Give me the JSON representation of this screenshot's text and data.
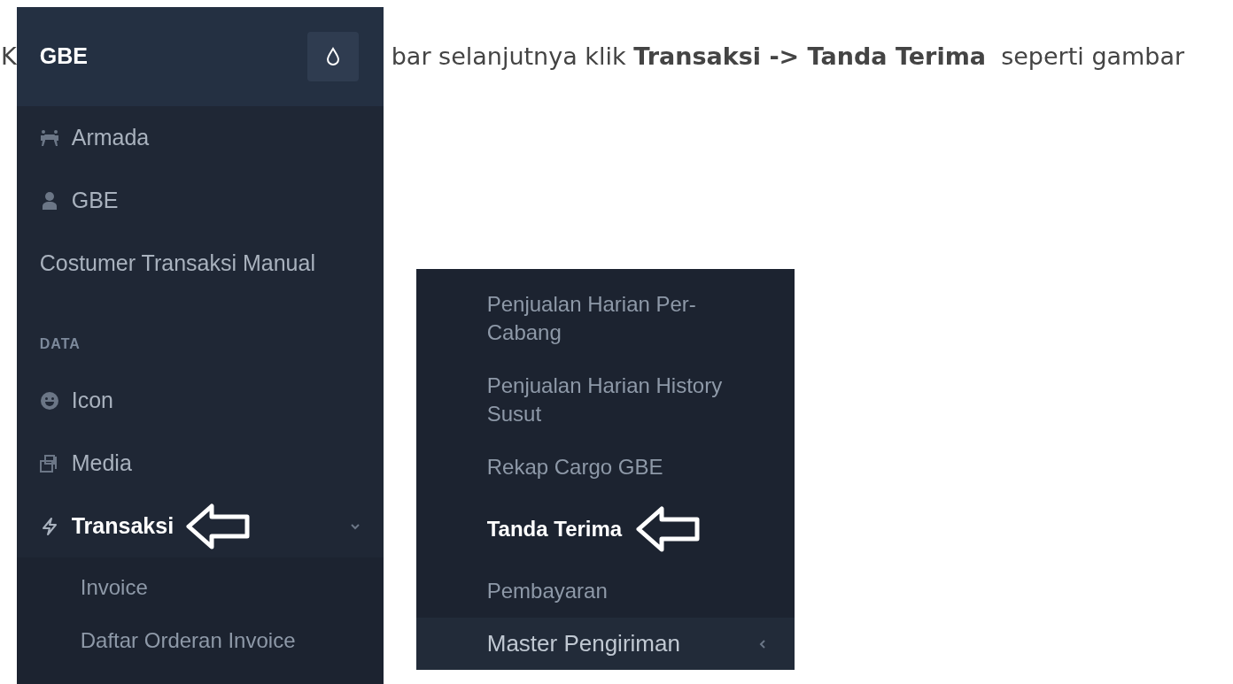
{
  "intro_text": {
    "start": "K",
    "rest": "bar selanjutnya klik **Transaksi -> Tanda Terima**  seperti gambar"
  },
  "screenshot_1": {
    "brand": "GBE",
    "menu": [
      {
        "kind": "item",
        "label": "Armada",
        "icon": true,
        "active": false,
        "arrow": false
      },
      {
        "kind": "item",
        "label": "GBE",
        "icon": true,
        "active": false,
        "arrow": false
      },
      {
        "kind": "item",
        "label": "Costumer Transaksi Manual",
        "icon": false,
        "active": false,
        "arrow": false
      },
      {
        "kind": "header",
        "label": "DATA"
      },
      {
        "kind": "item",
        "label": "Icon",
        "icon": true,
        "active": false,
        "arrow": false
      },
      {
        "kind": "item",
        "label": "Media",
        "icon": true,
        "active": false,
        "arrow": false
      },
      {
        "kind": "parent",
        "label": "Transaksi",
        "icon": true,
        "active": true,
        "arrow": true,
        "expanded": true,
        "children": [
          {
            "label": "Invoice",
            "active": false,
            "arrow": false
          },
          {
            "label": "Daftar Orderan Invoice",
            "active": false,
            "arrow": false
          }
        ]
      }
    ]
  },
  "screenshot_2": {
    "menu": [
      {
        "kind": "sub",
        "label": "Penjualan Harian Per-Cabang",
        "active": false,
        "arrow": false
      },
      {
        "kind": "sub",
        "label": "Penjualan Harian History Susut",
        "active": false,
        "arrow": false
      },
      {
        "kind": "sub",
        "label": "Rekap Cargo GBE",
        "active": false,
        "arrow": false
      },
      {
        "kind": "sub",
        "label": "Tanda Terima",
        "active": true,
        "arrow": true
      },
      {
        "kind": "sub",
        "label": "Pembayaran",
        "active": false,
        "arrow": false
      },
      {
        "kind": "parent",
        "label": "Master Pengiriman",
        "active": false,
        "arrow": false,
        "expanded": false
      }
    ]
  }
}
